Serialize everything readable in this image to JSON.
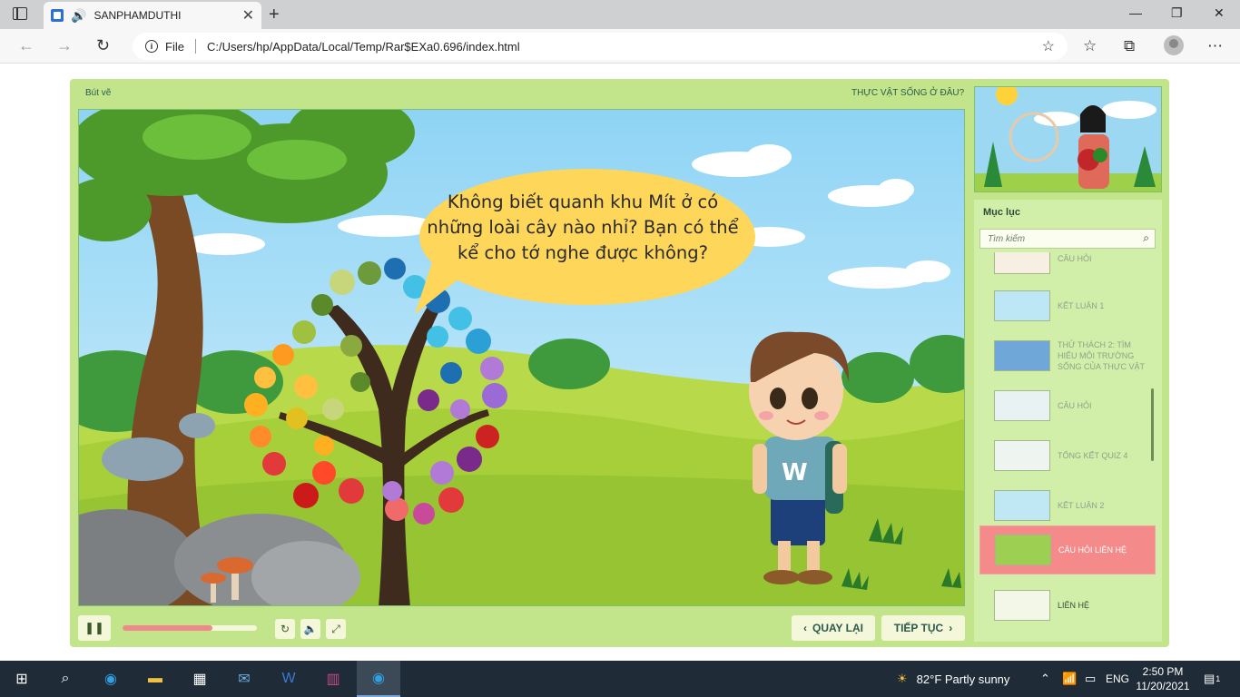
{
  "browser": {
    "tab_title": "SANPHAMDUTHI",
    "tab_close": "✕",
    "new_tab": "+",
    "address_scheme": "File",
    "address_url": "C:/Users/hp/AppData/Local/Temp/Rar$EXa0.696/index.html"
  },
  "player": {
    "top_left_label": "Bút vẽ",
    "top_right_label": "THỰC VẬT SỐNG Ở ĐÂU?",
    "bubble_text": "Không biết quanh khu Mít ở có những loài cây nào nhỉ? Bạn có thể kể cho tớ nghe được không?",
    "progress": 0.67,
    "back_label": "QUAY LẠI",
    "next_label": "TIẾP TỤC"
  },
  "toc": {
    "title": "Mục lục",
    "search_placeholder": "Tìm kiếm",
    "items": [
      {
        "label": "CÂU HỎI",
        "state": "normal"
      },
      {
        "label": "KẾT LUẬN 1",
        "state": "normal"
      },
      {
        "label": "THỬ THÁCH 2: TÌM HIỂU MÔI TRƯỜNG SỐNG CỦA THỰC VẬT",
        "state": "normal"
      },
      {
        "label": "CÂU HỎI",
        "state": "normal"
      },
      {
        "label": "TỔNG KẾT QUIZ 4",
        "state": "normal"
      },
      {
        "label": "KẾT LUẬN 2",
        "state": "normal"
      },
      {
        "label": "CÂU HỎI LIÊN HỆ",
        "state": "active"
      },
      {
        "label": "LIÊN HỆ",
        "state": "dark"
      }
    ]
  },
  "taskbar": {
    "weather": "82°F  Partly sunny",
    "language": "ENG",
    "time": "2:50 PM",
    "date": "11/20/2021",
    "notifications": "1"
  },
  "colors": {
    "player_bg": "#c2e58c",
    "active_item": "#f48a8a",
    "bubble": "#fdd65a"
  }
}
